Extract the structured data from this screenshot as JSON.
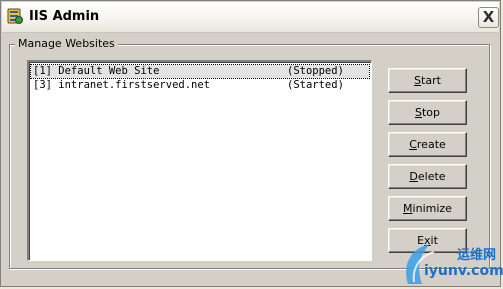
{
  "window": {
    "title": "IIS Admin",
    "close_label": "X"
  },
  "group": {
    "label": "Manage Websites"
  },
  "websites": [
    {
      "name": "[1] Default Web Site",
      "status": "(Stopped)",
      "selected": true
    },
    {
      "name": "[3] intranet.firstserved.net",
      "status": "(Started)",
      "selected": false
    }
  ],
  "buttons": {
    "start": {
      "acc": "S",
      "rest": "tart"
    },
    "stop": {
      "acc": "S",
      "rest": "top"
    },
    "create": {
      "acc": "C",
      "rest": "reate"
    },
    "delete": {
      "acc": "D",
      "rest": "elete"
    },
    "minimize": {
      "acc": "M",
      "rest": "inimize"
    },
    "exit": {
      "pre": "E",
      "acc": "x",
      "rest": "it"
    }
  },
  "watermark": {
    "line1": "运维网",
    "line2": "iyunv.com"
  },
  "colors": {
    "watermark": "#1e6fc7",
    "selection": "#e3e3e3"
  }
}
